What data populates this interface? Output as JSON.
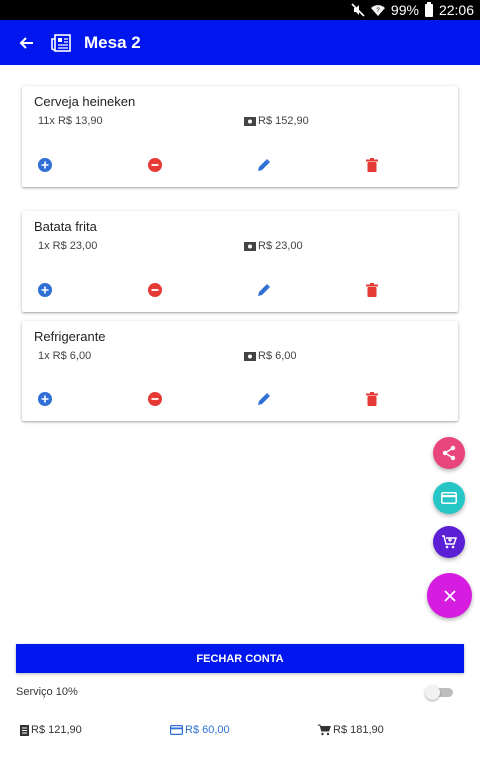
{
  "status_bar": {
    "battery": "99%",
    "time": "22:06"
  },
  "app_bar": {
    "title": "Mesa 2"
  },
  "items": [
    {
      "name": "Cerveja heineken",
      "quantity_price": "11x R$ 13,90",
      "total": "R$ 152,90"
    },
    {
      "name": "Batata frita",
      "quantity_price": "1x R$ 23,00",
      "total": "R$ 23,00"
    },
    {
      "name": "Refrigerante",
      "quantity_price": "1x R$ 6,00",
      "total": "R$ 6,00"
    }
  ],
  "footer": {
    "close_label": "FECHAR CONTA",
    "service_label": "Serviço 10%",
    "service_enabled": false,
    "summary": {
      "bill": "R$ 121,90",
      "card": "R$ 60,00",
      "cart": "R$ 181,90"
    }
  },
  "colors": {
    "primary": "#0016ef",
    "add": "#2f6fd6",
    "remove": "#e53935",
    "edit": "#2f6fd6",
    "delete": "#e53935",
    "fab_share": "#e8457c",
    "fab_card": "#26c6c6",
    "fab_cart": "#5b1fd6",
    "fab_close": "#d61ce0",
    "card_summary": "#2f6fd6"
  }
}
